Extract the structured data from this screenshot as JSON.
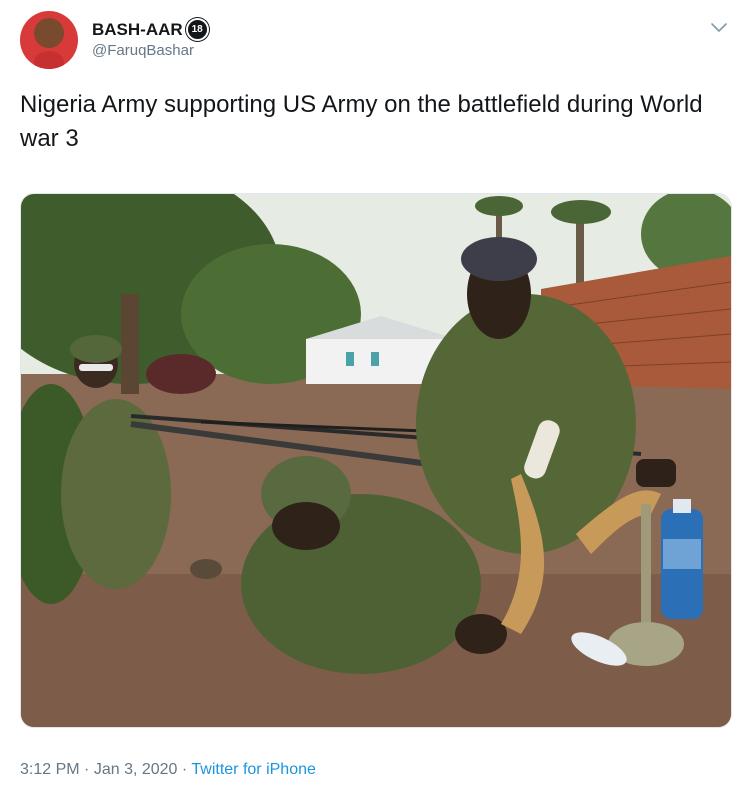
{
  "tweet": {
    "display_name": "BASH-AAR",
    "badge": "18",
    "handle": "@FaruqBashar",
    "text": "Nigeria Army supporting US Army on the battlefield during World war 3",
    "time": "3:12 PM",
    "date": "Jan 3, 2020",
    "separator": "·",
    "source": "Twitter for iPhone"
  },
  "icons": {
    "avatar": "profile-photo",
    "menu": "chevron-down-icon"
  },
  "colors": {
    "text": "#14171a",
    "secondary": "#657786",
    "link": "#1b95e0"
  }
}
